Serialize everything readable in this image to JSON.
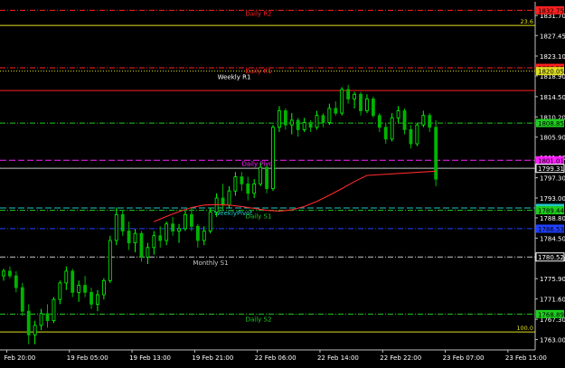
{
  "chart_data": {
    "type": "candlestick",
    "instrument_colors": {
      "background": "#000000",
      "axis": "#bfbfbf",
      "bull": "#00ff00",
      "bear": "#00b400",
      "ma": "#ff2a2a"
    },
    "y_ticks": [
      "1831.70",
      "1827.45",
      "1823.10",
      "1818.90",
      "1814.50",
      "1810.20",
      "1805.90",
      "1801.60",
      "1797.30",
      "1793.00",
      "1788.80",
      "1784.50",
      "1780.20",
      "1775.90",
      "1771.60",
      "1767.30",
      "1763.00"
    ],
    "ylim": [
      1760.8,
      1834.6
    ],
    "x_ticks": [
      "Feb 20:00",
      "19 Feb 05:00",
      "19 Feb 13:00",
      "19 Feb 21:00",
      "22 Feb 06:00",
      "22 Feb 14:00",
      "22 Feb 22:00",
      "23 Feb 07:00",
      "23 Feb 15:00"
    ],
    "x_tick_positions": [
      0.5,
      10.5,
      20.5,
      30.5,
      40.5,
      50.5,
      60.5,
      70.5,
      80.5
    ],
    "n_bars": 84,
    "hlines": [
      {
        "label": "Daily R2",
        "value": 1832.8,
        "color": "#ff2020",
        "style": "dashdot",
        "price_tag": "1832.75",
        "tag_bg": "#ff2020"
      },
      {
        "label": "",
        "value": 1829.6,
        "color": "#e0e020",
        "style": "solid",
        "price_tag": "23.6",
        "tag_bg": "none"
      },
      {
        "label": "Daily R1",
        "value": 1820.6,
        "color": "#ff2020",
        "style": "dashdot",
        "price_tag": "1820.55",
        "tag_bg": "#ff2020"
      },
      {
        "label": "Weekly R1",
        "value": 1819.9,
        "color": "#e0e020",
        "style": "dotted",
        "price_tag": "1820.05",
        "tag_bg": "#e0e020"
      },
      {
        "label": "",
        "value": 1815.8,
        "color": "#ff2020",
        "style": "solid",
        "price_tag": "",
        "tag_bg": "none"
      },
      {
        "label": "",
        "value": 1808.9,
        "color": "#1ecc1e",
        "style": "dashdot",
        "price_tag": "1808.85",
        "tag_bg": "#1ecc1e"
      },
      {
        "label": "Daily Pivot",
        "value": 1801.0,
        "color": "#ff20ff",
        "style": "dashed",
        "price_tag": "1801.01",
        "tag_bg": "#ff20ff"
      },
      {
        "label": "",
        "value": 1799.3,
        "color": "#c8c8c8",
        "style": "solid",
        "price_tag": "1799.31",
        "tag_bg": "#000000"
      },
      {
        "label": "WeeklyPivot",
        "value": 1790.9,
        "color": "#20c8c8",
        "style": "dashed",
        "price_tag": "1790.98",
        "tag_bg": "#20c8c8"
      },
      {
        "label": "Daily S1",
        "value": 1790.4,
        "color": "#1ecc1e",
        "style": "dashdot",
        "price_tag": "1789.44",
        "tag_bg": "#1ecc1e"
      },
      {
        "label": "",
        "value": 1786.5,
        "color": "#2040ff",
        "style": "dashdot",
        "price_tag": "1786.53",
        "tag_bg": "#2040ff"
      },
      {
        "label": "Monthly S1",
        "value": 1780.5,
        "color": "#c8c8c8",
        "style": "dashdot",
        "price_tag": "1780.52",
        "tag_bg": "#000000"
      },
      {
        "label": "Daily S2",
        "value": 1768.4,
        "color": "#1ecc1e",
        "style": "dashdot",
        "price_tag": "1768.89",
        "tag_bg": "#1ecc1e"
      },
      {
        "label": "",
        "value": 1764.6,
        "color": "#e0e020",
        "style": "solid",
        "price_tag": "100.0",
        "tag_bg": "none"
      }
    ],
    "candles_ohlc": [
      [
        1776.5,
        1778.0,
        1775.5,
        1777.5
      ],
      [
        1777.5,
        1778.5,
        1776.0,
        1776.5
      ],
      [
        1776.5,
        1777.5,
        1773.0,
        1774.0
      ],
      [
        1774.0,
        1775.0,
        1768.0,
        1769.0
      ],
      [
        1769.0,
        1770.5,
        1762.0,
        1764.0
      ],
      [
        1764.0,
        1767.0,
        1762.0,
        1766.0
      ],
      [
        1766.0,
        1769.5,
        1765.0,
        1768.5
      ],
      [
        1768.5,
        1770.5,
        1765.5,
        1767.0
      ],
      [
        1767.0,
        1772.0,
        1766.5,
        1771.5
      ],
      [
        1771.5,
        1775.5,
        1770.5,
        1775.0
      ],
      [
        1775.0,
        1778.5,
        1773.5,
        1777.5
      ],
      [
        1777.5,
        1778.0,
        1772.0,
        1773.0
      ],
      [
        1773.0,
        1775.5,
        1771.0,
        1774.5
      ],
      [
        1774.5,
        1776.5,
        1772.0,
        1773.0
      ],
      [
        1773.0,
        1774.0,
        1769.5,
        1770.5
      ],
      [
        1770.5,
        1773.5,
        1769.0,
        1772.5
      ],
      [
        1772.5,
        1776.0,
        1771.5,
        1775.5
      ],
      [
        1775.5,
        1785.0,
        1775.0,
        1784.0
      ],
      [
        1784.0,
        1791.0,
        1783.0,
        1789.5
      ],
      [
        1789.5,
        1790.5,
        1785.0,
        1786.0
      ],
      [
        1786.0,
        1788.0,
        1782.0,
        1783.5
      ],
      [
        1783.5,
        1786.5,
        1781.5,
        1785.5
      ],
      [
        1785.5,
        1786.0,
        1779.5,
        1780.5
      ],
      [
        1780.5,
        1783.5,
        1779.0,
        1782.5
      ],
      [
        1782.5,
        1786.0,
        1781.0,
        1785.0
      ],
      [
        1785.0,
        1787.0,
        1782.5,
        1784.0
      ],
      [
        1784.0,
        1788.0,
        1783.0,
        1787.5
      ],
      [
        1787.5,
        1789.0,
        1785.0,
        1786.0
      ],
      [
        1786.0,
        1787.5,
        1783.5,
        1786.5
      ],
      [
        1786.5,
        1790.5,
        1786.0,
        1789.5
      ],
      [
        1789.5,
        1791.0,
        1786.0,
        1787.0
      ],
      [
        1787.0,
        1787.5,
        1782.5,
        1784.0
      ],
      [
        1784.0,
        1787.0,
        1783.0,
        1786.0
      ],
      [
        1786.0,
        1791.0,
        1785.5,
        1790.0
      ],
      [
        1790.0,
        1794.0,
        1789.0,
        1793.0
      ],
      [
        1793.0,
        1796.0,
        1790.5,
        1791.5
      ],
      [
        1791.5,
        1795.5,
        1791.0,
        1794.5
      ],
      [
        1794.5,
        1798.5,
        1793.5,
        1797.5
      ],
      [
        1797.5,
        1798.5,
        1794.5,
        1796.0
      ],
      [
        1796.0,
        1797.5,
        1792.5,
        1794.0
      ],
      [
        1794.0,
        1797.0,
        1793.0,
        1796.0
      ],
      [
        1796.0,
        1800.5,
        1795.5,
        1799.5
      ],
      [
        1799.5,
        1800.0,
        1794.0,
        1795.0
      ],
      [
        1795.0,
        1808.5,
        1794.5,
        1808.0
      ],
      [
        1808.0,
        1812.5,
        1807.0,
        1811.5
      ],
      [
        1811.5,
        1812.0,
        1807.5,
        1808.5
      ],
      [
        1808.5,
        1811.0,
        1806.5,
        1809.5
      ],
      [
        1809.5,
        1810.0,
        1806.0,
        1807.5
      ],
      [
        1807.5,
        1810.0,
        1807.0,
        1809.0
      ],
      [
        1809.0,
        1809.5,
        1807.0,
        1808.0
      ],
      [
        1808.0,
        1811.5,
        1807.5,
        1810.5
      ],
      [
        1810.5,
        1811.0,
        1808.0,
        1809.0
      ],
      [
        1809.0,
        1813.0,
        1808.5,
        1812.0
      ],
      [
        1812.0,
        1813.5,
        1810.5,
        1811.0
      ],
      [
        1811.0,
        1816.5,
        1810.5,
        1816.0
      ],
      [
        1816.0,
        1817.0,
        1813.0,
        1814.0
      ],
      [
        1814.0,
        1815.5,
        1812.0,
        1815.0
      ],
      [
        1815.0,
        1815.5,
        1810.5,
        1811.5
      ],
      [
        1811.5,
        1815.0,
        1811.0,
        1814.0
      ],
      [
        1814.0,
        1814.5,
        1810.0,
        1810.5
      ],
      [
        1810.5,
        1811.0,
        1807.0,
        1808.0
      ],
      [
        1808.0,
        1809.0,
        1804.5,
        1805.5
      ],
      [
        1805.5,
        1811.0,
        1805.0,
        1810.0
      ],
      [
        1810.0,
        1812.5,
        1809.0,
        1811.5
      ],
      [
        1811.5,
        1812.0,
        1806.5,
        1807.5
      ],
      [
        1807.5,
        1808.5,
        1803.5,
        1804.5
      ],
      [
        1804.5,
        1809.0,
        1804.0,
        1808.5
      ],
      [
        1808.5,
        1811.5,
        1808.0,
        1810.5
      ],
      [
        1810.5,
        1811.0,
        1807.0,
        1808.0
      ],
      [
        1808.0,
        1809.5,
        1795.5,
        1797.0
      ]
    ],
    "ma_values": [
      1788.0,
      1789.1,
      1790.1,
      1791.0,
      1791.5,
      1791.6,
      1791.5,
      1791.2,
      1790.8,
      1790.4,
      1790.2,
      1790.5,
      1791.2,
      1792.3,
      1793.6,
      1795.0,
      1796.5,
      1797.8,
      1798.7
    ],
    "ma_x_bars": [
      24,
      26,
      28,
      30,
      32,
      34,
      36,
      38,
      40,
      42,
      44,
      46,
      48,
      50,
      52,
      54,
      56,
      58,
      69
    ]
  }
}
